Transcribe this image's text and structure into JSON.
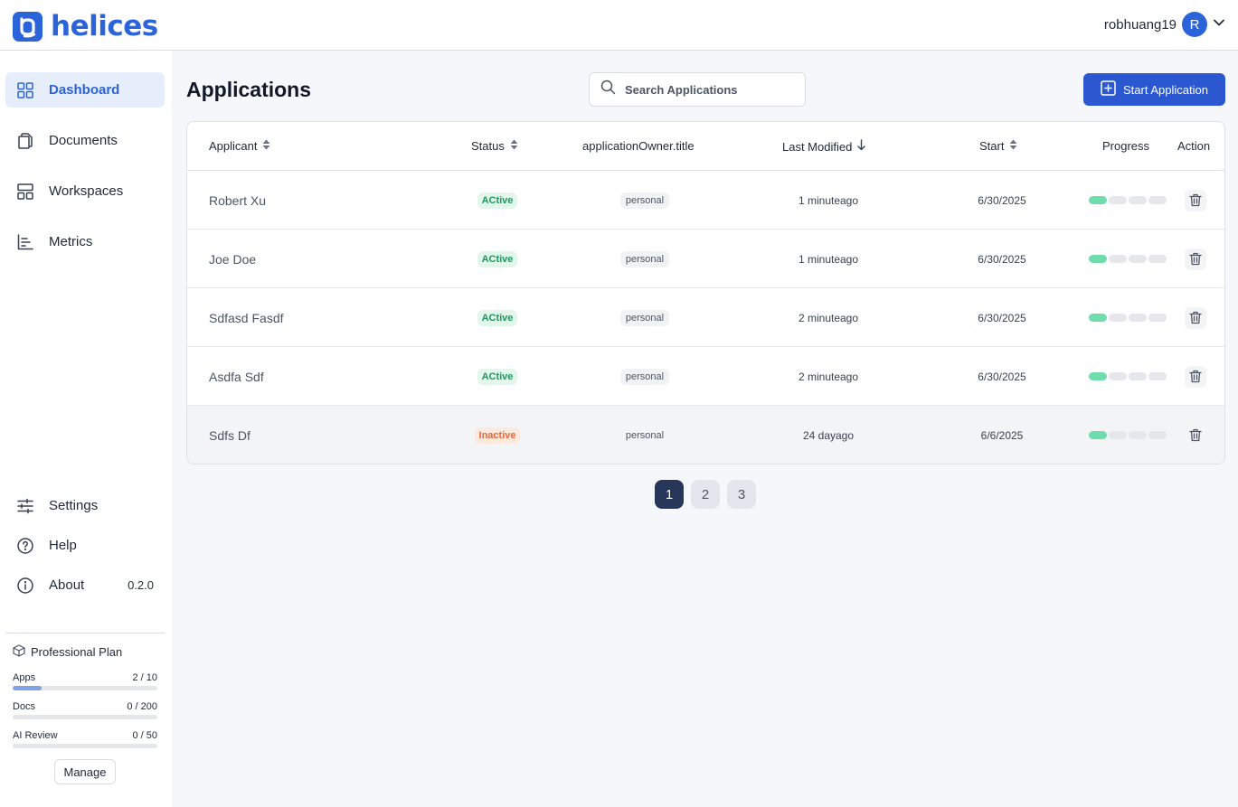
{
  "brand": {
    "name": "helices",
    "color": "#2b63d9"
  },
  "header": {
    "username": "robhuang19",
    "avatar_initial": "R"
  },
  "sidebar": {
    "items": [
      {
        "label": "Dashboard",
        "icon": "grid-icon",
        "active": true
      },
      {
        "label": "Documents",
        "icon": "documents-icon",
        "active": false
      },
      {
        "label": "Workspaces",
        "icon": "layout-icon",
        "active": false
      },
      {
        "label": "Metrics",
        "icon": "bar-chart-icon",
        "active": false
      }
    ],
    "bottom_items": [
      {
        "label": "Settings",
        "icon": "sliders-icon"
      },
      {
        "label": "Help",
        "icon": "help-circle-icon"
      },
      {
        "label": "About",
        "icon": "info-circle-icon",
        "version": "0.2.0"
      }
    ],
    "plan": {
      "title": "Professional Plan",
      "usage": [
        {
          "label": "Apps",
          "value": "2 / 10",
          "fraction": 0.2
        },
        {
          "label": "Docs",
          "value": "0 / 200",
          "fraction": 0
        },
        {
          "label": "AI Review",
          "value": "0 / 50",
          "fraction": 0
        }
      ],
      "manage_label": "Manage"
    }
  },
  "main": {
    "title": "Applications",
    "search_placeholder": "Search Applications",
    "start_button_label": "Start Application",
    "columns": [
      "Applicant",
      "Status",
      "applicationOwner.title",
      "Last Modified",
      "Start",
      "Progress",
      "Action"
    ],
    "rows": [
      {
        "applicant": "Robert Xu",
        "status": "ACtive",
        "owner": "personal",
        "last_modified": "1 minuteago",
        "start": "6/30/2025",
        "progress_steps_done": 1,
        "progress_steps_total": 4
      },
      {
        "applicant": "Joe Doe",
        "status": "ACtive",
        "owner": "personal",
        "last_modified": "1 minuteago",
        "start": "6/30/2025",
        "progress_steps_done": 1,
        "progress_steps_total": 4
      },
      {
        "applicant": "Sdfasd Fasdf",
        "status": "ACtive",
        "owner": "personal",
        "last_modified": "2 minuteago",
        "start": "6/30/2025",
        "progress_steps_done": 1,
        "progress_steps_total": 4
      },
      {
        "applicant": "Asdfa Sdf",
        "status": "ACtive",
        "owner": "personal",
        "last_modified": "2 minuteago",
        "start": "6/30/2025",
        "progress_steps_done": 1,
        "progress_steps_total": 4
      },
      {
        "applicant": "Sdfs Df",
        "status": "Inactive",
        "owner": "personal",
        "last_modified": "24 dayago",
        "start": "6/6/2025",
        "progress_steps_done": 1,
        "progress_steps_total": 4
      }
    ],
    "pagination": {
      "pages": [
        "1",
        "2",
        "3"
      ],
      "current": "1"
    }
  },
  "colors": {
    "accent": "#2b58d0",
    "active_badge": "#1a9a5a",
    "inactive_badge": "#e5693a",
    "progress_done": "#6fdcae"
  }
}
